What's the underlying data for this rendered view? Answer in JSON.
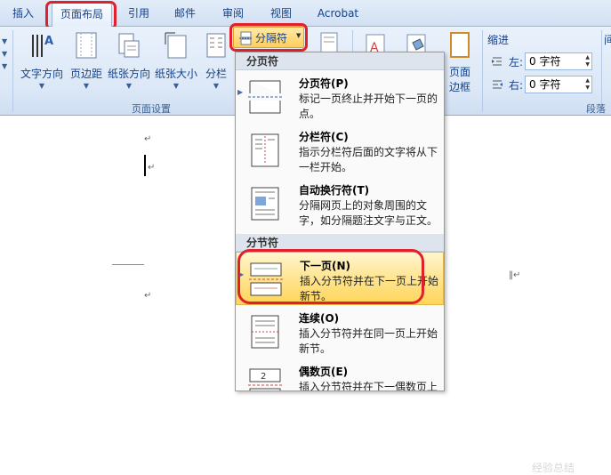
{
  "tabs": {
    "insert": "插入",
    "page_layout": "页面布局",
    "references": "引用",
    "mailings": "邮件",
    "review": "审阅",
    "view": "视图",
    "acrobat": "Acrobat"
  },
  "ribbon": {
    "text_direction": "文字方向",
    "margins": "页边距",
    "orientation": "纸张方向",
    "size": "纸张大小",
    "columns": "分栏",
    "breaks": "分隔符",
    "page_borders_1": "页面",
    "page_borders_2": "边框",
    "page_setup_group": "页面设置",
    "indent_label": "缩进",
    "indent_left_label": "左:",
    "indent_left_value": "0 字符",
    "indent_right_label": "右:",
    "indent_right_value": "0 字符",
    "paragraph_group": "段落",
    "spacing_partial": "间"
  },
  "menu": {
    "section_page_breaks": "分页符",
    "section_section_breaks": "分节符",
    "items": [
      {
        "title": "分页符(P)",
        "desc": "标记一页终止并开始下一页的点。"
      },
      {
        "title": "分栏符(C)",
        "desc": "指示分栏符后面的文字将从下一栏开始。"
      },
      {
        "title": "自动换行符(T)",
        "desc": "分隔网页上的对象周围的文字，如分隔题注文字与正文。"
      },
      {
        "title": "下一页(N)",
        "desc": "插入分节符并在下一页上开始新节。"
      },
      {
        "title": "连续(O)",
        "desc": "插入分节符并在同一页上开始新节。"
      },
      {
        "title": "偶数页(E)",
        "desc": "插入分节符并在下一偶数页上"
      }
    ]
  },
  "watermark": "经验总结",
  "colors": {
    "highlight": "#ffe38a",
    "annotation_red": "#e0202a",
    "tab_text": "#15428b"
  }
}
